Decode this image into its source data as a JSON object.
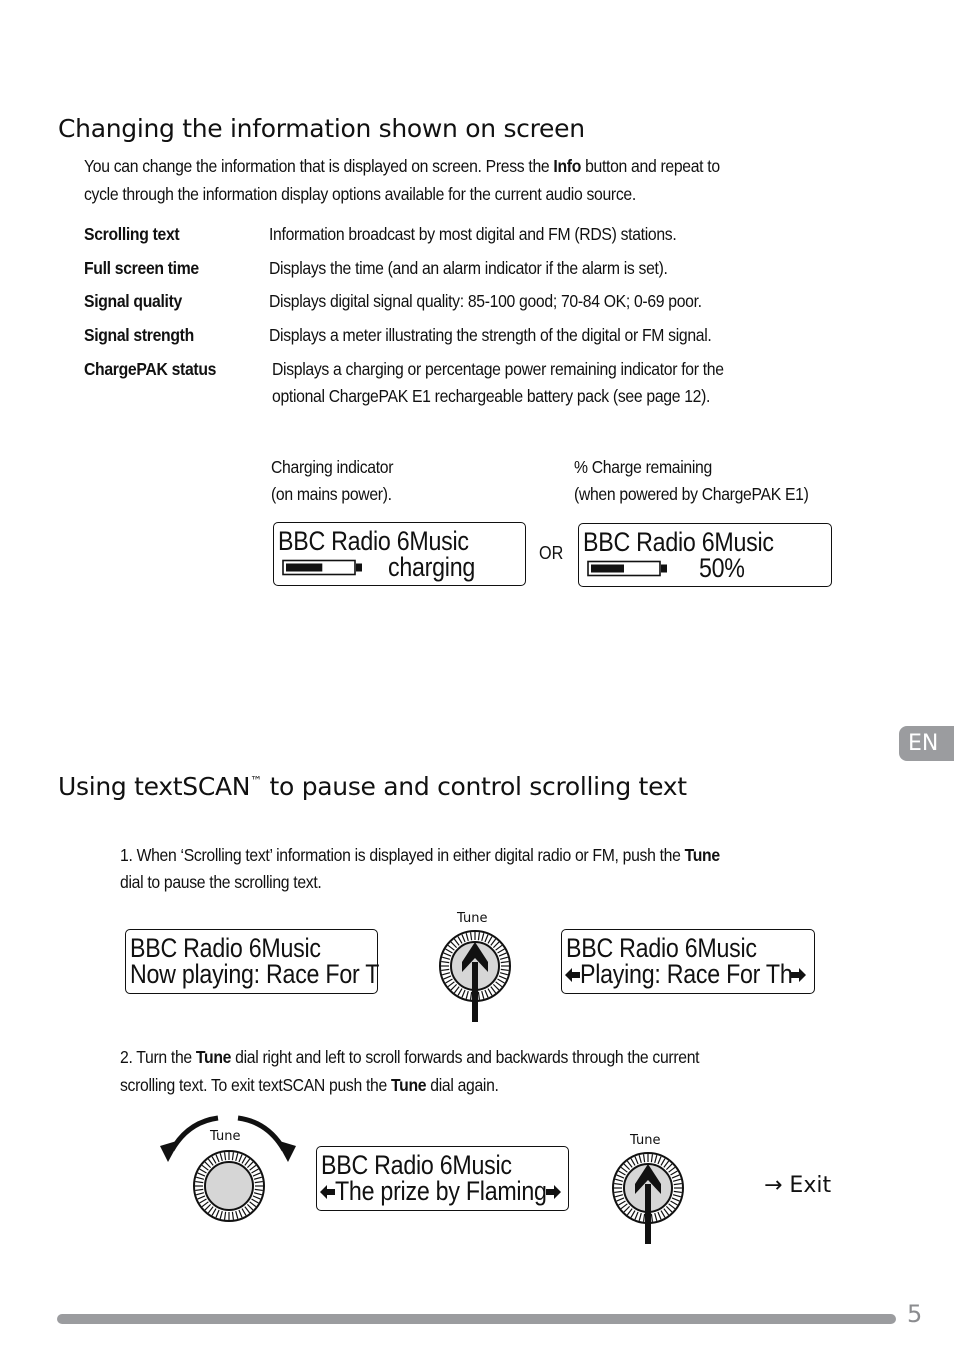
{
  "section1": {
    "title": "Changing the information shown on screen",
    "intro_part1": "You can change the information that is displayed on screen. Press the ",
    "intro_bold": "Info",
    "intro_part2": " button and repeat to",
    "intro_line2": "cycle through the information display options available for the current audio source.",
    "options": [
      {
        "term": "Scrolling text",
        "desc": "Information broadcast by most digital and FM (RDS) stations."
      },
      {
        "term": "Full screen time",
        "desc": "Displays the time (and an alarm indicator if the alarm is set)."
      },
      {
        "term": "Signal quality",
        "desc": "Displays digital signal quality: 85-100 good; 70-84 OK; 0-69 poor."
      },
      {
        "term": "Signal strength",
        "desc": "Displays a meter illustrating the strength of the digital or FM signal."
      },
      {
        "term": "ChargePAK status",
        "desc": "Displays a charging or percentage power remaining indicator for the",
        "desc2": "optional ChargePAK E1 rechargeable battery pack (see page 12)."
      }
    ],
    "charging_caption1": "Charging indicator",
    "charging_caption2": "(on mains power).",
    "remaining_caption1": "% Charge remaining",
    "remaining_caption2": "(when powered by ChargePAK E1)",
    "or_label": "OR",
    "display_charging": {
      "line1": "BBC Radio 6Music",
      "line2": "charging",
      "battery_level_fraction": 0.55
    },
    "display_percent": {
      "line1": "BBC Radio 6Music",
      "line2": "50%",
      "battery_level_fraction": 0.5
    }
  },
  "en_tab": "EN",
  "section2": {
    "title_part1": "Using textSCAN",
    "title_tm": "™",
    "title_part2": " to pause and control scrolling text",
    "step1_part1": "1. When ‘Scrolling text’ information is displayed in either digital radio or FM, push the ",
    "step1_bold": "Tune",
    "step1_line2": "dial to pause the scrolling text.",
    "display_before": {
      "line1": "BBC Radio 6Music",
      "line2": "Now playing: Race For T"
    },
    "display_paused": {
      "line1": "BBC Radio 6Music",
      "line2": "Playing: Race For Th"
    },
    "tune_label": "Tune",
    "step2_part1": "2. Turn the ",
    "step2_bold1": "Tune",
    "step2_part2": " dial right and left to scroll forwards and backwards through the current",
    "step2_line2_part1": "scrolling text. To exit textSCAN push the ",
    "step2_bold2": "Tune",
    "step2_line2_part2": " dial again.",
    "display_scroll": {
      "line1": "BBC Radio 6Music",
      "line2": "The prize by Flaming"
    },
    "exit_label": "→ Exit"
  },
  "footer": {
    "page_number": "5"
  }
}
